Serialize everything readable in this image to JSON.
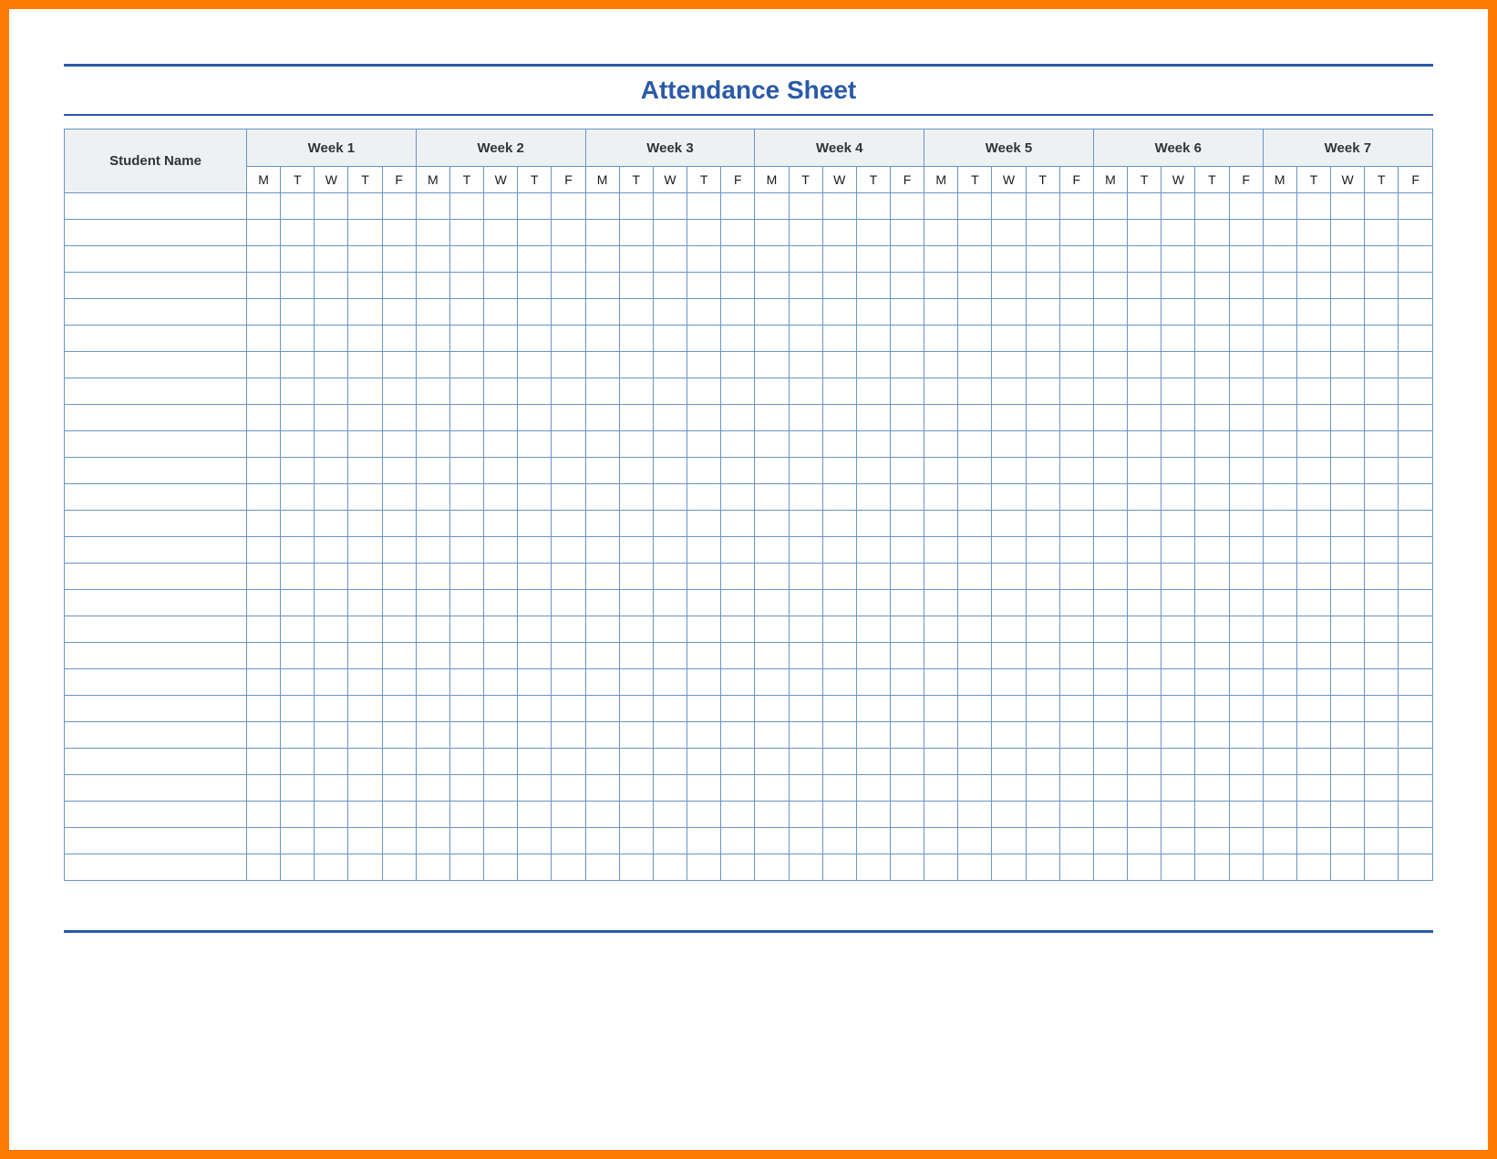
{
  "title": "Attendance Sheet",
  "columns": {
    "name_header": "Student Name",
    "weeks": [
      "Week 1",
      "Week 2",
      "Week 3",
      "Week 4",
      "Week 5",
      "Week 6",
      "Week 7"
    ],
    "days": [
      "M",
      "T",
      "W",
      "T",
      "F"
    ]
  },
  "row_count": 26,
  "colors": {
    "frame": "#ff7a00",
    "rule": "#2a5aa8",
    "grid": "#6a93c9",
    "header_bg": "#eef1f4"
  }
}
